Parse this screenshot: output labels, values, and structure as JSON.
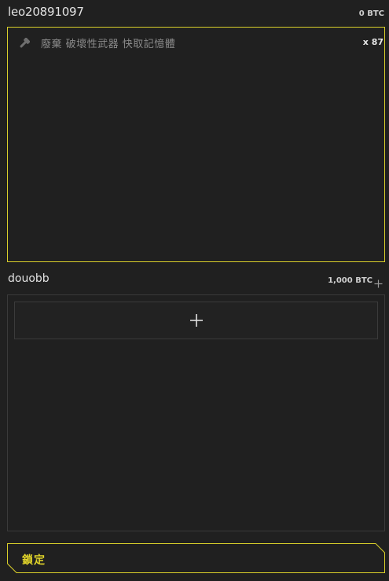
{
  "player1": {
    "name": "leo20891097",
    "balance": "0 BTC",
    "items": [
      {
        "name": "廢棄 破壞性武器 快取記憶體",
        "quantity": "x 87",
        "icon": "hammer-icon"
      }
    ]
  },
  "player2": {
    "name": "douobb",
    "balance": "1,000 BTC",
    "add_icon": "plus-icon"
  },
  "lock_button": {
    "label": "鎖定"
  },
  "colors": {
    "background": "#202020",
    "accent": "#d9cf2a",
    "panel_border": "#3a3a3a"
  }
}
